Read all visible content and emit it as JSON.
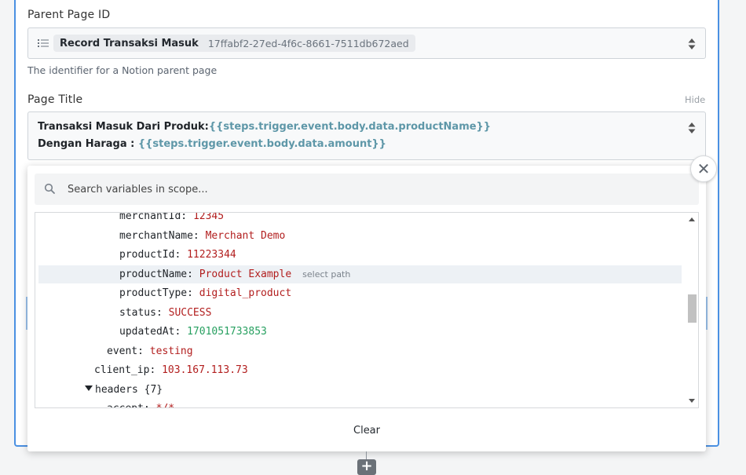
{
  "parent_page": {
    "label": "Parent Page ID",
    "selected_name": "Record Transaksi Masuk",
    "selected_id": "17ffabf2-27ed-4f6c-8661-7511db672aed",
    "help": "The identifier for a Notion parent page"
  },
  "page_title": {
    "label": "Page Title",
    "hide_label": "Hide",
    "line1_text": "Transaksi Masuk Dari Produk:",
    "line1_var": "{{steps.trigger.event.body.data.productName}}",
    "line2_text": "Dengan Haraga : ",
    "line2_var": "{{steps.trigger.event.body.data.amount}}"
  },
  "variables_popup": {
    "close_symbol": "✕",
    "search_placeholder": "Search variables in scope...",
    "clear_label": "Clear",
    "select_path_hint": "select path",
    "rows": [
      {
        "key": "merchantId",
        "value": "12345",
        "kind": "num"
      },
      {
        "key": "merchantName",
        "value": "Merchant Demo",
        "kind": "str"
      },
      {
        "key": "productId",
        "value": "11223344",
        "kind": "num"
      },
      {
        "key": "productName",
        "value": "Product Example",
        "kind": "str"
      },
      {
        "key": "productType",
        "value": "digital_product",
        "kind": "str"
      },
      {
        "key": "status",
        "value": "SUCCESS",
        "kind": "str"
      },
      {
        "key": "updatedAt",
        "value": "1701051733853",
        "kind": "num"
      },
      {
        "key": "event",
        "value": "testing",
        "kind": "str"
      },
      {
        "key": "client_ip",
        "value": "103.167.113.73",
        "kind": "str"
      },
      {
        "key": "headers {7}",
        "value": ""
      },
      {
        "key": "accept",
        "value": "*/*",
        "kind": "str"
      }
    ]
  },
  "add_step": {
    "symbol": "+"
  },
  "colors": {
    "accent": "#4a90e2",
    "string_value": "#b21e1e",
    "number_value": "#27a060",
    "template_var": "#5e97a8"
  }
}
